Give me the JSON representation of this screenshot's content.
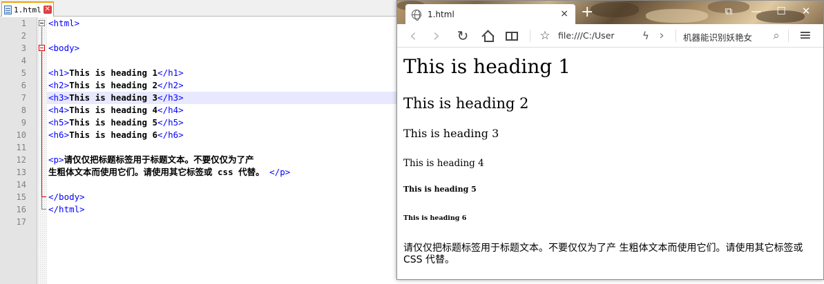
{
  "editor": {
    "tab": {
      "label": "1.html"
    },
    "line_numbers": [
      "1",
      "2",
      "3",
      "4",
      "5",
      "6",
      "7",
      "8",
      "9",
      "10",
      "11",
      "12",
      "13",
      "14",
      "15",
      "16",
      "17"
    ],
    "code": {
      "html_open": "<html>",
      "body_open": "<body>",
      "h1_open": "<h1>",
      "h1_text": "This is heading 1",
      "h1_close": "</h1>",
      "h2_open": "<h2>",
      "h2_text": "This is heading 2",
      "h2_close": "</h2>",
      "h3_open": "<h3>",
      "h3_text": "This is heading 3",
      "h3_close": "</h3>",
      "h4_open": "<h4>",
      "h4_text": "This is heading 4",
      "h4_close": "</h4>",
      "h5_open": "<h5>",
      "h5_text": "This is heading 5",
      "h5_close": "</h5>",
      "h6_open": "<h6>",
      "h6_text": "This is heading 6",
      "h6_close": "</h6>",
      "p_open": "<p>",
      "p_text_line1": "请仅仅把标题标签用于标题文本。不要仅仅为了产",
      "p_text_line2": "生粗体文本而使用它们。请使用其它标签或 css 代替。",
      "p_close": "</p>",
      "body_close": "</body>",
      "html_close": "</html>"
    }
  },
  "browser": {
    "tab": {
      "title": "1.html",
      "close": "×"
    },
    "new_tab": "+",
    "window_controls": {
      "minimize": "—",
      "maximize": "☐",
      "close": "✕",
      "extra": "⧉"
    },
    "nav": {
      "back": "‹",
      "forward": "›",
      "reload": "↻",
      "bookmark": "☆",
      "address": "file:///C:/User",
      "lightning": "ϟ",
      "expand": "›",
      "search_text": "机器能识别妖艳女",
      "search_icon": "⌕",
      "menu": "≡"
    },
    "page": {
      "h1": "This is heading 1",
      "h2": "This is heading 2",
      "h3": "This is heading 3",
      "h4": "This is heading 4",
      "h5": "This is heading 5",
      "h6": "This is heading 6",
      "p": "请仅仅把标题标签用于标题文本。不要仅仅为了产 生粗体文本而使用它们。请使用其它标签或 CSS 代替。"
    }
  }
}
